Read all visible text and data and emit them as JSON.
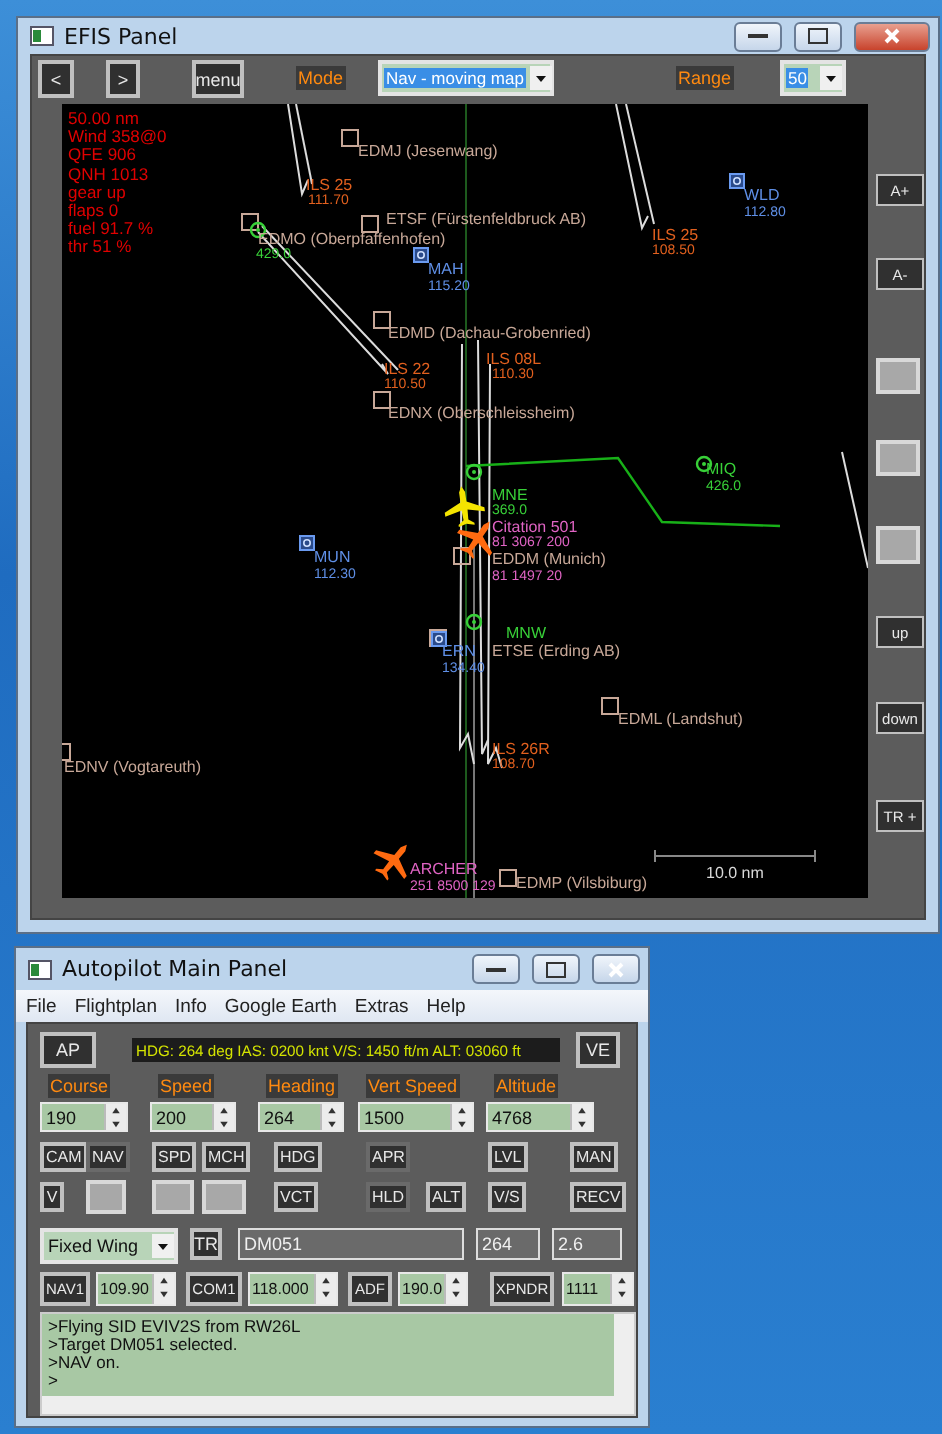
{
  "efis_window": {
    "title": "EFIS Panel",
    "toolbar": {
      "prev": "<",
      "next": ">",
      "menu": "menu",
      "mode_label": "Mode",
      "mode_value": "Nav - moving map",
      "range_label": "Range",
      "range_value": "50"
    },
    "map": {
      "info": [
        "50.00 nm",
        "Wind 358@0",
        "QFE 906",
        "QNH 1013",
        "gear up",
        "flaps 0",
        "fuel 91.7 %",
        "thr 51 %"
      ],
      "airports": [
        "EDMJ (Jesenwang)",
        "EDMO (Oberpfaffenhofen)",
        "ETSF (Fürstenfeldbruck AB)",
        "EDMD (Dachau-Grobenried)",
        "EDNX (Oberschleissheim)",
        "EDDM (Munich)",
        "ETSE (Erding AB)",
        "EDML (Landshut)",
        "EDNV (Vogtareuth)",
        "EDMP (Vilsbiburg)"
      ],
      "vors": [
        {
          "ident": "MAH",
          "freq": "115.20"
        },
        {
          "ident": "WLD",
          "freq": "112.80"
        },
        {
          "ident": "MUN",
          "freq": "112.30"
        },
        {
          "ident": "ERN",
          "freq": "134.40"
        }
      ],
      "ils": [
        {
          "ident": "ILS 25",
          "freq": "111.70"
        },
        {
          "ident": "ILS 25",
          "freq": "108.50"
        },
        {
          "ident": "ILS 22",
          "freq": "110.50"
        },
        {
          "ident": "ILS 08L",
          "freq": "110.30"
        },
        {
          "ident": "ILS 26R",
          "freq": "108.70"
        }
      ],
      "ndbs": [
        {
          "freq": "429.0"
        },
        {
          "ident": "MNE",
          "freq": "369.0"
        },
        {
          "ident": "MIQ",
          "freq": "426.0"
        },
        {
          "ident": "MNW"
        }
      ],
      "traffic": [
        {
          "kind": "own"
        },
        {
          "kind": "other",
          "callsign": "Citation 501",
          "data": "81 3067 200"
        },
        {
          "kind": "label",
          "data": "81 1497 20"
        },
        {
          "kind": "other",
          "callsign": "ARCHER",
          "data": "251 8500 129"
        }
      ],
      "scale": "10.0 nm"
    },
    "side_buttons": [
      {
        "kind": "text",
        "label": "A+"
      },
      {
        "kind": "text",
        "label": "A-"
      },
      {
        "kind": "blank"
      },
      {
        "kind": "blank"
      },
      {
        "kind": "blank"
      },
      {
        "kind": "text",
        "label": "up"
      },
      {
        "kind": "text",
        "label": "down"
      },
      {
        "kind": "text",
        "label": "TR +"
      }
    ]
  },
  "autopilot_window": {
    "title": "Autopilot Main Panel",
    "menu": [
      "File",
      "Flightplan",
      "Info",
      "Google Earth",
      "Extras",
      "Help"
    ],
    "ap_button": "AP",
    "status": "HDG: 264 deg IAS: 0200 knt V/S: 1450 ft/m ALT: 03060 ft",
    "ve_button": "VE",
    "settings": [
      {
        "label": "Course",
        "value": "190"
      },
      {
        "label": "Speed",
        "value": "200"
      },
      {
        "label": "Heading",
        "value": "264"
      },
      {
        "label": "Vert Speed",
        "value": "1500"
      },
      {
        "label": "Altitude",
        "value": "4768"
      }
    ],
    "button_rows": [
      [
        {
          "kind": "text",
          "label": "CAM",
          "on": false
        },
        {
          "kind": "text",
          "label": "NAV",
          "on": true
        },
        {
          "kind": "text",
          "label": "SPD",
          "on": false
        },
        {
          "kind": "text",
          "label": "MCH",
          "on": false
        },
        {
          "kind": "text",
          "label": "HDG",
          "on": false
        },
        {
          "kind": "text",
          "label": "APR",
          "on": true
        },
        {
          "kind": "text",
          "label": "LVL",
          "on": false
        },
        {
          "kind": "text",
          "label": "MAN",
          "on": false
        }
      ],
      [
        {
          "kind": "text",
          "label": "V",
          "on": false
        },
        {
          "kind": "blank"
        },
        {
          "kind": "blank"
        },
        {
          "kind": "blank"
        },
        {
          "kind": "text",
          "label": "VCT",
          "on": false
        },
        {
          "kind": "text",
          "label": "HLD",
          "on": true
        },
        {
          "kind": "text",
          "label": "ALT",
          "on": false
        },
        {
          "kind": "text",
          "label": "V/S",
          "on": false
        },
        {
          "kind": "text",
          "label": "RECV",
          "on": false
        }
      ]
    ],
    "aircraft_type": "Fixed Wing",
    "tr_button": "TR",
    "target": "DM051",
    "target_heading": "264",
    "target_distance": "2.6",
    "radios": [
      {
        "label": "NAV1",
        "value": "109.90",
        "on": false
      },
      {
        "label": "COM1",
        "value": "118.000",
        "on": false
      },
      {
        "label": "ADF",
        "value": "190.0",
        "on": false
      },
      {
        "label": "XPNDR",
        "value": "1111",
        "on": false
      }
    ],
    "log": [
      ">Flying SID EVIV2S from RW26L",
      ">Target DM051 selected.",
      ">NAV on.",
      ">"
    ]
  }
}
